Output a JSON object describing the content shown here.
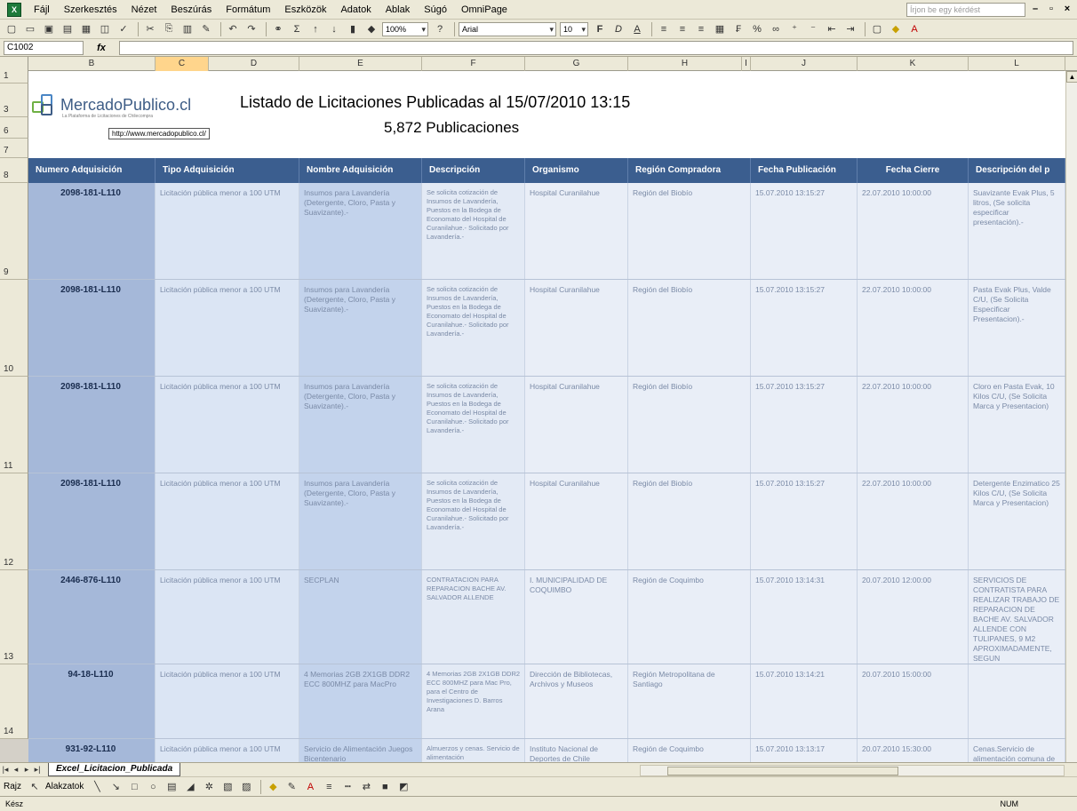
{
  "menubar": {
    "items": [
      "Fájl",
      "Szerkesztés",
      "Nézet",
      "Beszúrás",
      "Formátum",
      "Eszközök",
      "Adatok",
      "Ablak",
      "Súgó",
      "OmniPage"
    ],
    "help_placeholder": "Írjon be egy kérdést"
  },
  "toolbar": {
    "zoom": "100%",
    "font": "Arial",
    "font_size": "10"
  },
  "formula_bar": {
    "cell_ref": "C1002",
    "fx": "fx",
    "content": ""
  },
  "columns": [
    "B",
    "C",
    "D",
    "E",
    "F",
    "G",
    "H",
    "I",
    "J",
    "K",
    "L"
  ],
  "active_column": "C",
  "rows": [
    "1",
    "3",
    "6",
    "7",
    "8",
    "9",
    "10",
    "11",
    "12",
    "13",
    "14"
  ],
  "sheet": {
    "logo_text": "MercadoPublico",
    "logo_suffix": ".cl",
    "logo_sub": "La Plataforma de Licitaciones de Chilecompra",
    "logo_link": "http://www.mercadopublico.cl/",
    "title": "Listado de Licitaciones Publicadas al 15/07/2010 13:15",
    "count": "5,872  Publicaciones"
  },
  "table": {
    "headers": [
      "Numero Adquisición",
      "Tipo Adquisición",
      "Nombre Adquisición",
      "Descripción",
      "Organismo",
      "Región Compradora",
      "Fecha Publicación",
      "Fecha Cierre",
      "Descripción del p"
    ],
    "rows": [
      [
        "2098-181-L110",
        "Licitación pública menor a 100 UTM",
        "Insumos para Lavandería (Detergente, Cloro, Pasta y Suavizante).-",
        "Se solicita cotización de Insumos de Lavandería, Puestos en la Bodega de Economato del Hospital de Curanilahue.- Solicitado por Lavandería.-",
        "Hospital Curanilahue",
        "Región del Biobío",
        "15.07.2010 13:15:27",
        "22.07.2010 10:00:00",
        "Suavizante Evak Plus, 5 litros, (Se solicita especificar presentación).-"
      ],
      [
        "2098-181-L110",
        "Licitación pública menor a 100 UTM",
        "Insumos para Lavandería (Detergente, Cloro, Pasta y Suavizante).-",
        "Se solicita cotización de Insumos de Lavandería, Puestos en la Bodega de Economato del Hospital de Curanilahue.- Solicitado por Lavandería.-",
        "Hospital Curanilahue",
        "Región del Biobío",
        "15.07.2010 13:15:27",
        "22.07.2010 10:00:00",
        "Pasta Evak Plus, Valde C/U, (Se Solicita Especificar Presentacion).-"
      ],
      [
        "2098-181-L110",
        "Licitación pública menor a 100 UTM",
        "Insumos para Lavandería (Detergente, Cloro, Pasta y Suavizante).-",
        "Se solicita cotización de Insumos de Lavandería, Puestos en la Bodega de Economato del Hospital de Curanilahue.- Solicitado por Lavandería.-",
        "Hospital Curanilahue",
        "Región del Biobío",
        "15.07.2010 13:15:27",
        "22.07.2010 10:00:00",
        "Cloro en Pasta Evak, 10 Kilos C/U, (Se Solicita Marca y Presentacion)"
      ],
      [
        "2098-181-L110",
        "Licitación pública menor a 100 UTM",
        "Insumos para Lavandería (Detergente, Cloro, Pasta y Suavizante).-",
        "Se solicita cotización de Insumos de Lavandería, Puestos en la Bodega de Economato del Hospital de Curanilahue.- Solicitado por Lavandería.-",
        "Hospital Curanilahue",
        "Región del Biobío",
        "15.07.2010 13:15:27",
        "22.07.2010 10:00:00",
        "Detergente Enzimatico 25 Kilos C/U, (Se Solicita Marca y Presentacion)"
      ],
      [
        "2446-876-L110",
        "Licitación pública menor a 100 UTM",
        "SECPLAN",
        "CONTRATACION PARA REPARACION BACHE AV. SALVADOR ALLENDE",
        "I. MUNICIPALIDAD DE COQUIMBO",
        "Región de Coquimbo",
        "15.07.2010 13:14:31",
        "20.07.2010 12:00:00",
        "SERVICIOS DE CONTRATISTA PARA REALIZAR TRABAJO DE REPARACION DE BACHE AV. SALVADOR ALLENDE CON TULIPANES, 9 M2 APROXIMADAMENTE, SEGUN ESPECIFICACIONES TECNICAS, ANEXO ADJUNTO."
      ],
      [
        "94-18-L110",
        "Licitación pública menor a 100 UTM",
        "4 Memorias 2GB 2X1GB DDR2 ECC 800MHZ para MacPro",
        "4 Memorias 2GB 2X1GB DDR2 ECC 800MHZ para Mac Pro, para el Centro de Investigaciones D. Barros Arana",
        "Dirección de Bibliotecas, Archivos y Museos",
        "Región Metropolitana de Santiago",
        "15.07.2010 13:14:21",
        "20.07.2010 15:00:00",
        ""
      ],
      [
        "931-92-L110",
        "Licitación pública menor a 100 UTM",
        "Servicio de Alimentación Juegos Bicentenario",
        "Almuerzos y cenas. Servicio de alimentación",
        "Instituto Nacional de Deportes de Chile",
        "Región de Coquimbo",
        "15.07.2010 13:13:17",
        "20.07.2010 15:30:00",
        "Cenas.Servicio de alimentación comuna de Illapel para"
      ]
    ]
  },
  "sheet_tab": "Excel_Licitacion_Publicada",
  "drawbar": {
    "draw_label": "Rajz",
    "autoshapes_label": "Alakzatok"
  },
  "status": {
    "left": "Kész",
    "right": "NUM"
  }
}
